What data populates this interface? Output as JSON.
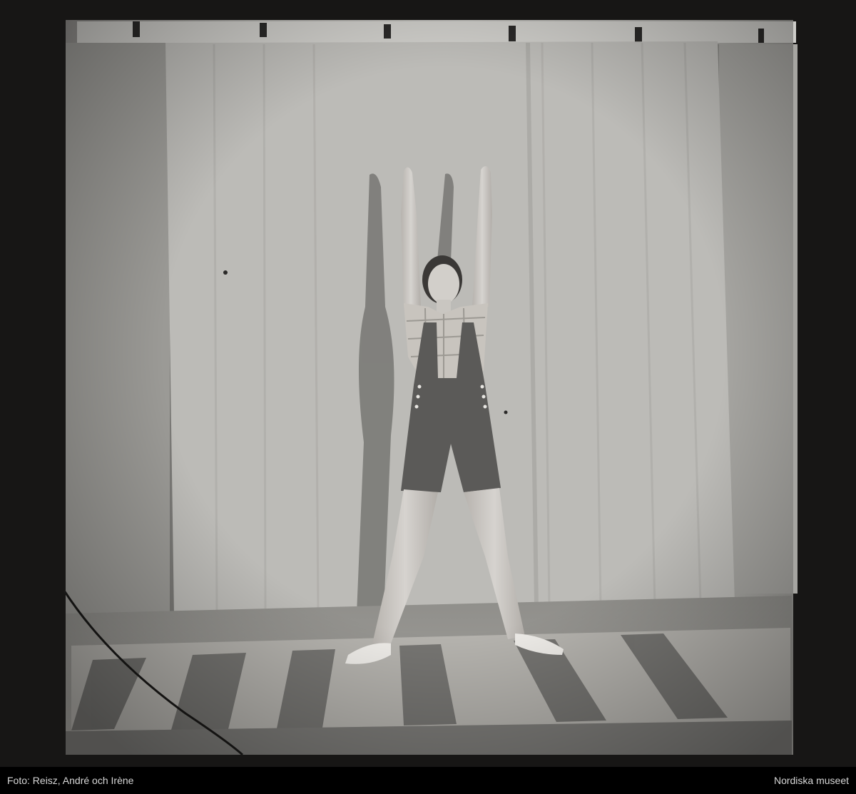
{
  "caption": {
    "credit": "Foto: Reisz, André och Irène",
    "source": "Nordiska museet"
  },
  "colors": {
    "border": "#171615",
    "backdrop": "#b8b7b3",
    "wall": "#a9a8a4",
    "floor": "#9f9d98",
    "shadow": "#4b4a48",
    "caption_bg": "#000000",
    "caption_text": "#d8d8d8"
  },
  "image": {
    "subject": "dancer-arms-raised",
    "style": "black-and-white-photograph"
  }
}
